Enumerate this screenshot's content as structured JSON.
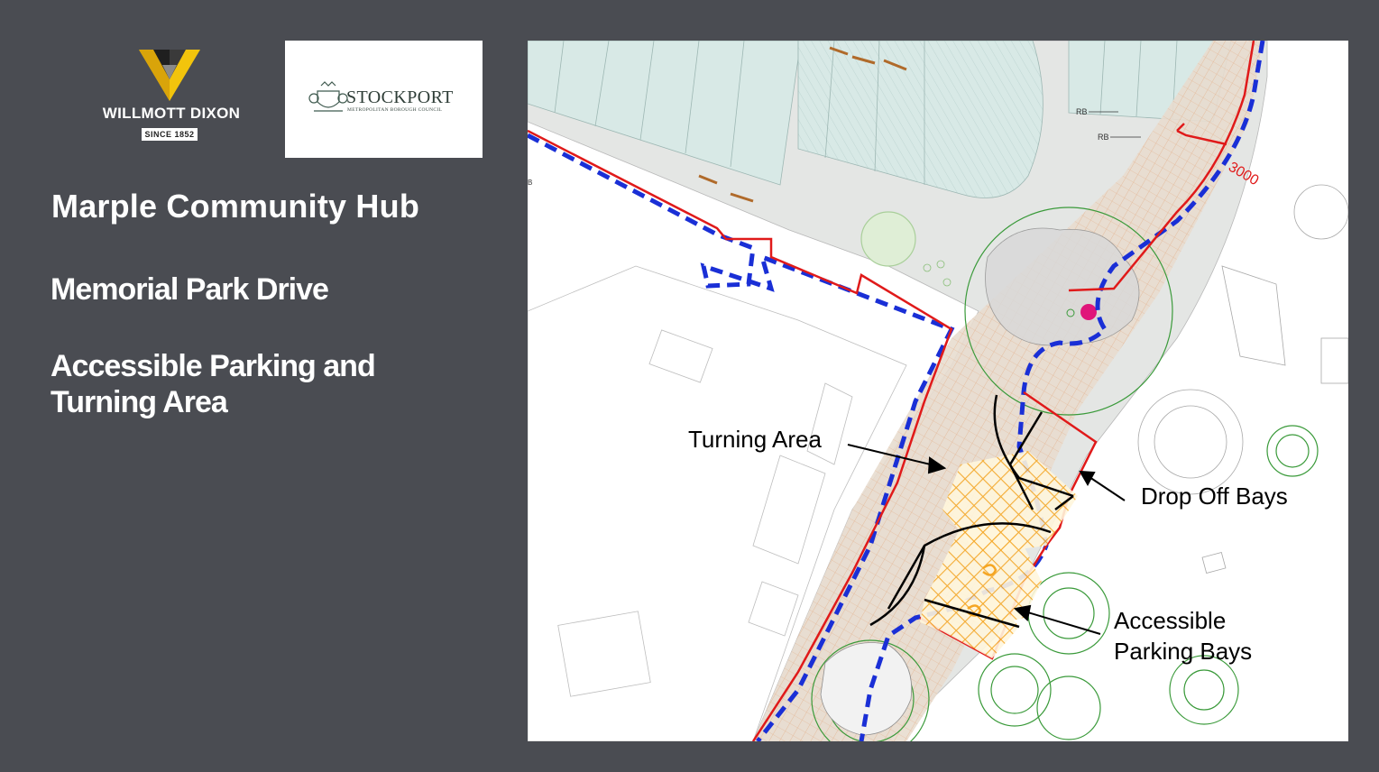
{
  "logos": {
    "willmott_dixon": {
      "name": "WILLMOTT DIXON",
      "since": "SINCE 1852"
    },
    "stockport": {
      "name": "STOCKPORT",
      "subtitle": "METROPOLITAN BOROUGH COUNCIL"
    }
  },
  "heading": {
    "title": "Marple Community Hub",
    "subtitle": "Memorial Park Drive",
    "description": "Accessible Parking and Turning Area"
  },
  "plan": {
    "labels": {
      "turning_area": "Turning Area",
      "drop_off_bays": "Drop Off Bays",
      "accessible_line1": "Accessible",
      "accessible_line2": "Parking Bays"
    },
    "annotations": {
      "rb1": "RB",
      "rb2": "RB",
      "dimension": "3000",
      "edge_letter": "B"
    },
    "colors": {
      "red_boundary": "#e01a1a",
      "blue_boundary": "#1a2fd6",
      "hatch_orange": "#f5a623",
      "tree_green": "#3a9a3a",
      "building_fill": "#d8e9e6",
      "road_fill": "#e4e6e4"
    }
  }
}
